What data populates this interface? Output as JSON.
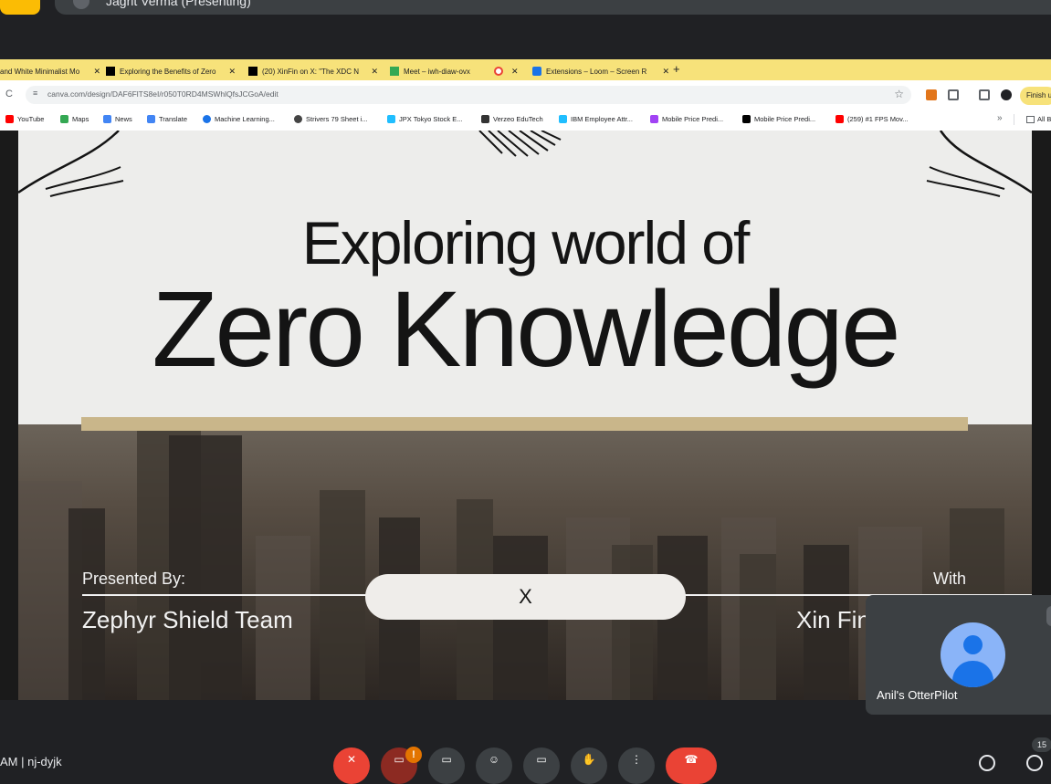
{
  "meet": {
    "presenter_text": "Jagrit Verma (Presenting)",
    "meeting_name": "AM | nj-dyjk",
    "self_view_name": "Anil's OtterPilot",
    "participants_count": "15"
  },
  "browser": {
    "tabs": [
      {
        "label": "and White Minimalist Mo",
        "close": "✕",
        "active": false
      },
      {
        "label": "Exploring the Benefits of Zero",
        "close": "✕",
        "active": false
      },
      {
        "label": "(20) XinFin on X: \"The XDC N",
        "close": "✕",
        "active": false
      },
      {
        "label": "Meet – iwh-diaw-ovx",
        "close": "✕",
        "active": true
      },
      {
        "label": "",
        "close": "✕",
        "active": false
      },
      {
        "label": "Extensions – Loom – Screen R",
        "close": "✕",
        "active": false
      }
    ],
    "new_tab": "+",
    "url": "canva.com/design/DAF6FlTS8eI/r050T0RD4MSWhlQfsJCGoA/edit",
    "finish_label": "Finish u",
    "bookmarks": [
      {
        "label": "YouTube",
        "color": "#ff0000"
      },
      {
        "label": "Maps",
        "color": "#34a853"
      },
      {
        "label": "News",
        "color": "#4285f4"
      },
      {
        "label": "Translate",
        "color": "#4285f4"
      },
      {
        "label": "Machine Learning...",
        "color": "#1a73e8"
      },
      {
        "label": "Strivers 79 Sheet i...",
        "color": "#444444"
      },
      {
        "label": "JPX Tokyo Stock E...",
        "color": "#20beff"
      },
      {
        "label": "Verzeo EduTech",
        "color": "#333333"
      },
      {
        "label": "IBM Employee Attr...",
        "color": "#20beff"
      },
      {
        "label": "Mobile Price Predi...",
        "color": "#a142f4"
      },
      {
        "label": "Mobile Price Predi...",
        "color": "#000000"
      },
      {
        "label": "(259) #1 FPS Mov...",
        "color": "#ff0000"
      }
    ],
    "bookmarks_more": "»",
    "all_bookmarks": "All B"
  },
  "slide": {
    "title_line1": "Exploring world of",
    "title_line2": "Zero Knowledge",
    "presented_by_label": "Presented By:",
    "team_name": "Zephyr Shield Team",
    "x_label": "X",
    "with_label": "With",
    "partner_name": "Xin Fin"
  },
  "colors": {
    "gold_bar": "#c9b68a",
    "tabstrip": "#f7e27a",
    "meet_bg": "#202124",
    "end_call": "#ea4335"
  }
}
